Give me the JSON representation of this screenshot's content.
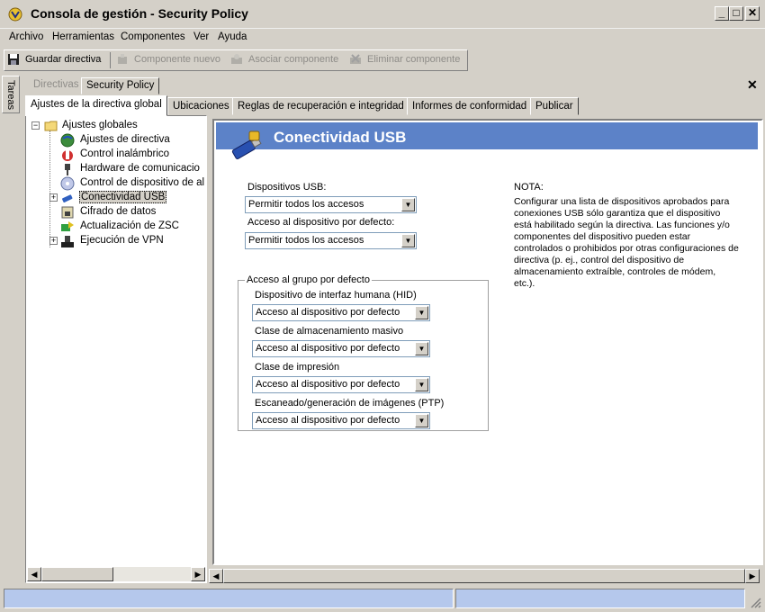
{
  "window": {
    "title": "Consola de gestión - Security Policy",
    "minimize_glyph": "_",
    "maximize_glyph": "□",
    "close_glyph": "✕"
  },
  "menu": [
    "Archivo",
    "Herramientas",
    "Componentes",
    "Ver",
    "Ayuda"
  ],
  "toolbar": {
    "save_label": "Guardar directiva",
    "new_component_label": "Componente nuevo",
    "associate_component_label": "Asociar componente",
    "delete_component_label": "Eliminar componente"
  },
  "tasks_label": "Tareas",
  "doc_tabs": [
    "Directivas",
    "Security Policy"
  ],
  "close_pane_glyph": "✕",
  "policy_tabs": [
    "Ajustes de la directiva global",
    "Ubicaciones",
    "Reglas de recuperación e integridad",
    "Informes de conformidad",
    "Publicar"
  ],
  "tree": {
    "root": "Ajustes globales",
    "items": [
      "Ajustes de directiva",
      "Control inalámbrico",
      "Hardware de comunicacio",
      "Control de dispositivo de al",
      "Conectividad USB",
      "Cifrado de datos",
      "Actualización de ZSC",
      "Ejecución de VPN"
    ],
    "selected": "Conectividad USB"
  },
  "panel": {
    "title": "Conectividad USB",
    "usb_devices_label": "Dispositivos USB:",
    "usb_devices_value": "Permitir todos los accesos",
    "default_access_label": "Acceso al dispositivo por defecto:",
    "default_access_value": "Permitir todos los accesos",
    "group_title": "Acceso al grupo por defecto",
    "groups": [
      {
        "label": "Dispositivo de interfaz humana (HID)",
        "value": "Acceso al dispositivo por defecto"
      },
      {
        "label": "Clase de almacenamiento masivo",
        "value": "Acceso al dispositivo por defecto"
      },
      {
        "label": "Clase de impresión",
        "value": "Acceso al dispositivo por defecto"
      },
      {
        "label": "Escaneado/generación de imágenes (PTP)",
        "value": "Acceso al dispositivo por defecto"
      }
    ],
    "note_title": "NOTA:",
    "note_text": "Configurar una lista de dispositivos aprobados para conexiones USB sólo garantiza que el dispositivo está habilitado según la directiva. Las funciones y/o componentes del dispositivo pueden estar controlados o prohibidos por otras configuraciones de directiva (p. ej., control del dispositivo de almacenamiento extraíble, controles de módem, etc.)."
  },
  "colors": {
    "header_bar": "#5c82c8",
    "status_bar": "#b5c8ec",
    "selected_item": "#d4d0c8"
  }
}
